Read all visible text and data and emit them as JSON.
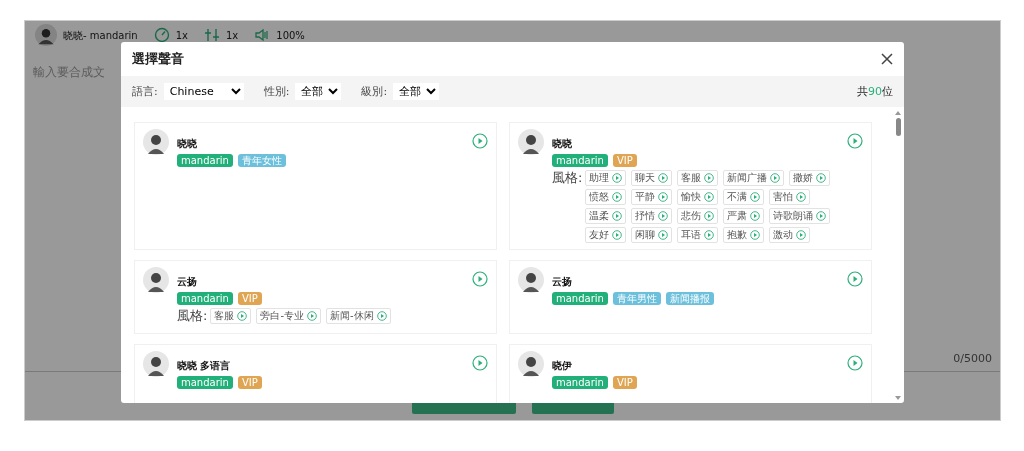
{
  "background": {
    "voice_label": "晓晓- mandarin",
    "speed": "1x",
    "pitch": "1x",
    "volume": "100%",
    "placeholder": "輸入要合成文",
    "counter": "0/5000"
  },
  "dialog": {
    "title": "選擇聲音",
    "filters": [
      {
        "label": "語言:",
        "value": "Chinese"
      },
      {
        "label": "性別:",
        "value": "全部"
      },
      {
        "label": "級別:",
        "value": "全部"
      }
    ],
    "total_prefix": "共",
    "total": "90",
    "total_suffix": "位",
    "voices": [
      {
        "name": "晓晓",
        "tags": [
          {
            "text": "mandarin",
            "kind": "language"
          },
          {
            "text": "青年女性",
            "kind": "category"
          }
        ]
      },
      {
        "name": "晓晓",
        "tags": [
          {
            "text": "mandarin",
            "kind": "language"
          },
          {
            "text": "VIP",
            "kind": "vip"
          }
        ],
        "styles_label": "風格:",
        "styles": [
          "助理",
          "聊天",
          "客服",
          "新闻广播",
          "撒娇",
          "愤怒",
          "平静",
          "愉快",
          "不满",
          "害怕",
          "温柔",
          "抒情",
          "悲伤",
          "严肃",
          "诗歌朗诵",
          "友好",
          "闲聊",
          "耳语",
          "抱歉",
          "激动"
        ]
      },
      {
        "name": "云扬",
        "tags": [
          {
            "text": "mandarin",
            "kind": "language"
          },
          {
            "text": "VIP",
            "kind": "vip"
          }
        ],
        "styles_label": "風格:",
        "styles": [
          "客服",
          "旁白-专业",
          "新闻-休闲"
        ]
      },
      {
        "name": "云扬",
        "tags": [
          {
            "text": "mandarin",
            "kind": "language"
          },
          {
            "text": "青年男性",
            "kind": "category"
          },
          {
            "text": "新闻播报",
            "kind": "category"
          }
        ]
      },
      {
        "name": "晓晓 多语言",
        "tags": [
          {
            "text": "mandarin",
            "kind": "language"
          },
          {
            "text": "VIP",
            "kind": "vip"
          }
        ]
      },
      {
        "name": "晓伊",
        "tags": [
          {
            "text": "mandarin",
            "kind": "language"
          },
          {
            "text": "VIP",
            "kind": "vip"
          }
        ]
      }
    ]
  }
}
